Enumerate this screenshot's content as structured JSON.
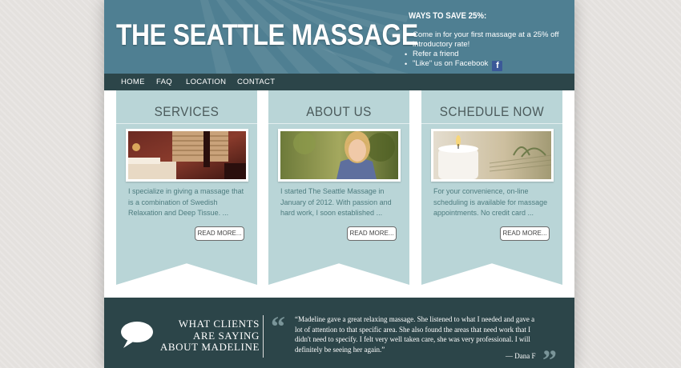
{
  "header": {
    "site_title": "THE SEATTLE MASSAGE",
    "save_title": "WAYS TO SAVE 25%:",
    "save_items": [
      "Come in for your first massage at a 25% off introductory rate!",
      "Refer a friend",
      "\"Like\" us on Facebook"
    ],
    "facebook_icon": "facebook-icon"
  },
  "nav": {
    "items": [
      "HOME",
      "FAQ",
      "LOCATION",
      "CONTACT"
    ]
  },
  "columns": [
    {
      "title": "SERVICES",
      "text": "I specialize in giving a massage that is a combination of Swedish Relaxation and Deep Tissue. ...",
      "button": "READ MORE..."
    },
    {
      "title": "ABOUT US",
      "text": "I started The Seattle Massage in January of 2012. With passion and hard work, I soon established ...",
      "button": "READ MORE..."
    },
    {
      "title": "SCHEDULE NOW",
      "text": "For your convenience, on-line scheduling is available for massage appointments. No credit card ...",
      "button": "READ MORE..."
    }
  ],
  "testimonials": {
    "heading_lines": [
      "WHAT CLIENTS",
      "ARE SAYING",
      "ABOUT MADELINE"
    ],
    "quote": "“Madeline gave a great relaxing massage. She listened to what I needed and gave a lot of attention to that specific area. She also found the areas that need work that I didn't need to specify. I felt very well taken care, she was very professional. I will definitely be seeing her again.”",
    "author": "— Dana F"
  },
  "colors": {
    "header_bg": "#4f7f92",
    "nav_bg": "#2c4549",
    "column_bg": "#b9d5d7",
    "column_text": "#4d7c7f"
  }
}
